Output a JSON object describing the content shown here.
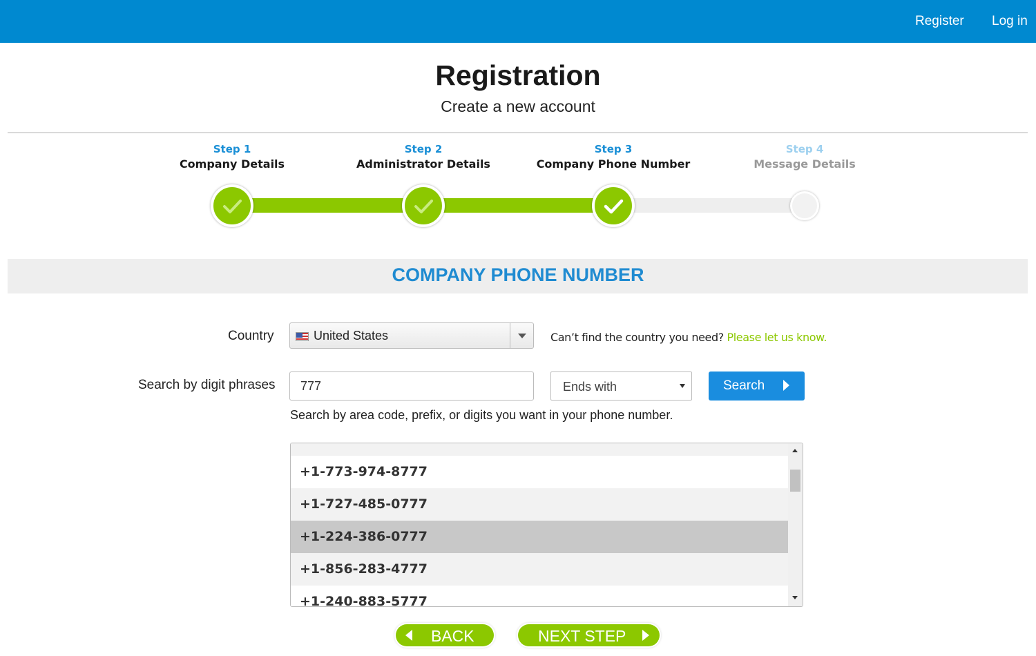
{
  "nav": {
    "register": "Register",
    "login": "Log in"
  },
  "header": {
    "title": "Registration",
    "subtitle": "Create a new account"
  },
  "steps": [
    {
      "number": "Step 1",
      "name": "Company Details",
      "status": "completed"
    },
    {
      "number": "Step 2",
      "name": "Administrator Details",
      "status": "completed"
    },
    {
      "number": "Step 3",
      "name": "Company Phone Number",
      "status": "current"
    },
    {
      "number": "Step 4",
      "name": "Message Details",
      "status": "pending"
    }
  ],
  "section": {
    "title": "COMPANY PHONE NUMBER"
  },
  "country": {
    "label": "Country",
    "value": "United States",
    "help_text": "Can’t find the country you need?",
    "help_link": "Please let us know."
  },
  "search": {
    "label": "Search by digit phrases",
    "value": "777",
    "match_mode": "Ends with",
    "button": "Search",
    "hint": "Search by area code, prefix, or digits you want in your phone number."
  },
  "results": {
    "numbers": [
      "+1-773-974-8777",
      "+1-727-485-0777",
      "+1-224-386-0777",
      "+1-856-283-4777",
      "+1-240-883-5777"
    ],
    "selected": "+1-224-386-0777"
  },
  "actions": {
    "back": "BACK",
    "next": "NEXT STEP"
  },
  "colors": {
    "brand_blue": "#0089d0",
    "accent_green": "#8cc800",
    "link_blue": "#1a8fd6"
  }
}
